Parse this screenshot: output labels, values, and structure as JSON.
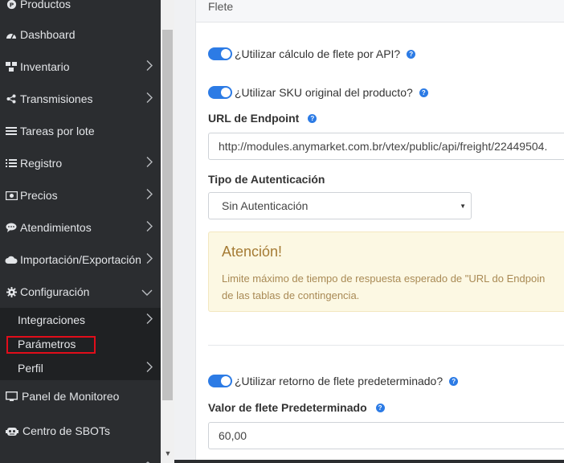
{
  "sidebar": {
    "items": [
      {
        "label": "Productos",
        "icon": "product-icon",
        "has_chevron": false
      },
      {
        "label": "Dashboard",
        "icon": "dashboard-icon",
        "has_chevron": false
      },
      {
        "label": "Inventario",
        "icon": "inventory-icon",
        "has_chevron": true
      },
      {
        "label": "Transmisiones",
        "icon": "share-icon",
        "has_chevron": true
      },
      {
        "label": "Tareas por lote",
        "icon": "list-icon",
        "has_chevron": false
      },
      {
        "label": "Registro",
        "icon": "list-icon",
        "has_chevron": true
      },
      {
        "label": "Precios",
        "icon": "money-icon",
        "has_chevron": true
      },
      {
        "label": "Atendimientos",
        "icon": "chat-icon",
        "has_chevron": true
      },
      {
        "label": "Importación/Exportación",
        "icon": "cloud-icon",
        "has_chevron": true
      },
      {
        "label": "Configuración",
        "icon": "gear-icon",
        "has_chevron": true
      }
    ],
    "submenu": [
      {
        "label": "Integraciones",
        "has_chevron": true
      },
      {
        "label": "Parámetros",
        "has_chevron": false
      },
      {
        "label": "Perfil",
        "has_chevron": true
      }
    ],
    "bottom_items": [
      {
        "label": "Panel de Monitoreo",
        "icon": "monitor-icon"
      },
      {
        "label": "Centro de SBOTs",
        "icon": "robot-icon"
      }
    ]
  },
  "panel": {
    "heading": "Flete",
    "toggle_api": {
      "label": "¿Utilizar cálculo de flete por API?",
      "on": true
    },
    "toggle_sku": {
      "label": "¿Utilizar SKU original del producto?",
      "on": true
    },
    "endpoint": {
      "label": "URL de Endpoint",
      "value": "http://modules.anymarket.com.br/vtex/public/api/freight/22449504."
    },
    "auth": {
      "label": "Tipo de Autenticación",
      "selected": "Sin Autenticación"
    },
    "alert": {
      "title": "Atención!",
      "line1": "Limite máximo de tiempo de respuesta esperado de \"URL do Endpoin",
      "line2": "de las tablas de contingencia."
    },
    "toggle_default": {
      "label": "¿Utilizar retorno de flete predeterminado?",
      "on": true
    },
    "default_value": {
      "label": "Valor de flete Predeterminado",
      "value": "60,00"
    }
  },
  "colors": {
    "accent": "#2c7be5",
    "sidebar": "#2b2d30",
    "alert_bg": "#fcf8e3",
    "highlight": "#e10d1a"
  }
}
